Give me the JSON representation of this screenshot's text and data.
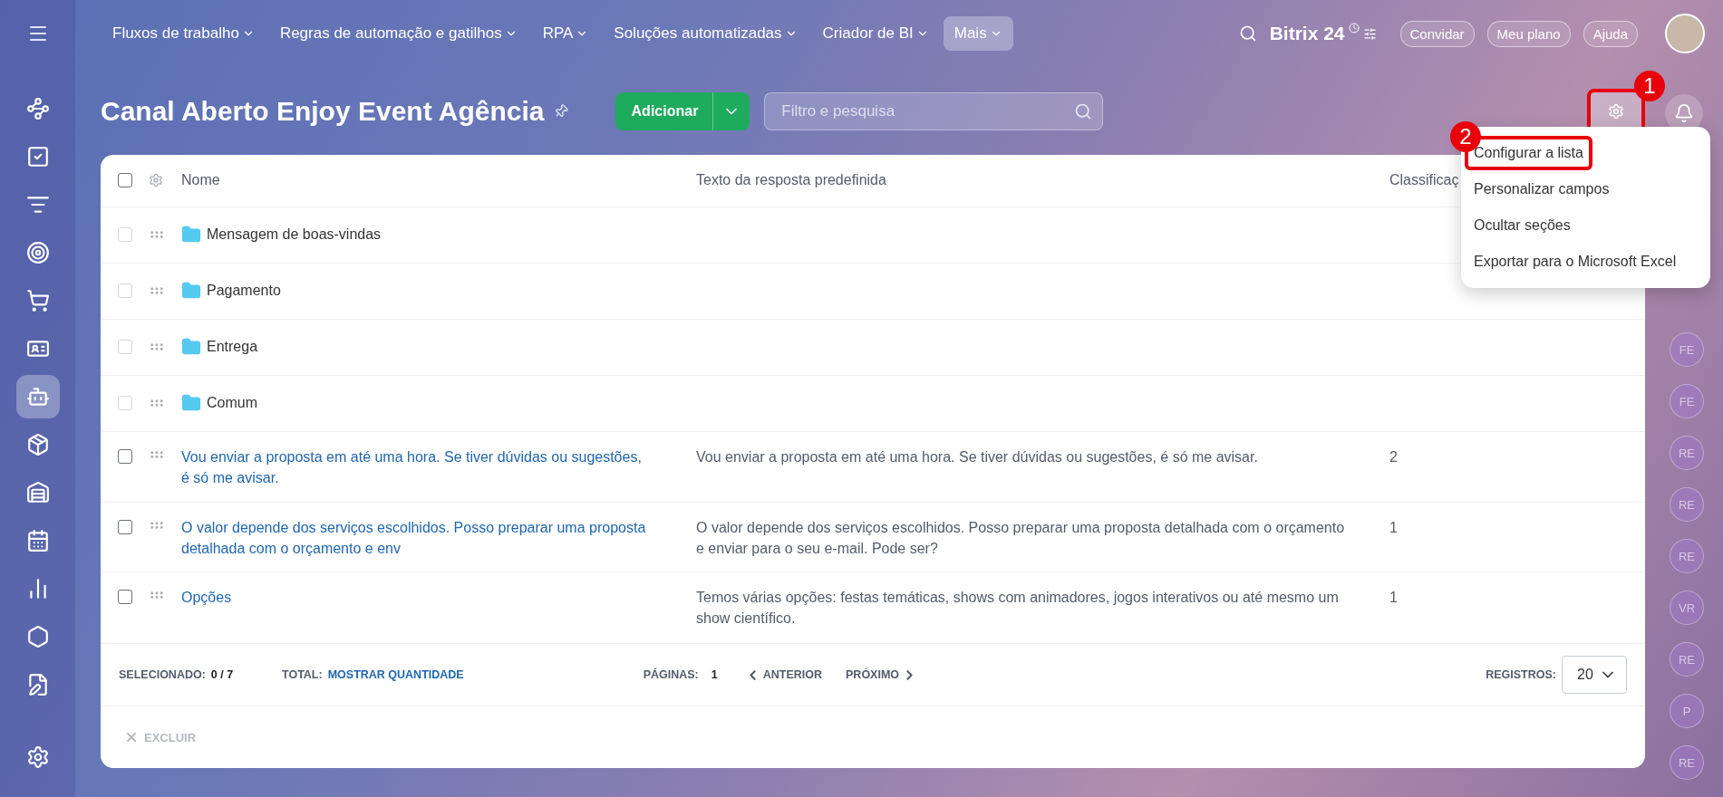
{
  "top_bar": {
    "nav": [
      {
        "label": "Fluxos de trabalho",
        "selected": false
      },
      {
        "label": "Regras de automação e gatilhos",
        "selected": false
      },
      {
        "label": "RPA",
        "selected": false
      },
      {
        "label": "Soluções automatizadas",
        "selected": false
      },
      {
        "label": "Criador de BI",
        "selected": false
      },
      {
        "label": "Mais",
        "selected": true
      }
    ],
    "logo": {
      "name": "Bitrix",
      "number": "24"
    },
    "buttons": [
      "Convidar",
      "Meu plano",
      "Ajuda"
    ]
  },
  "sidebar": {
    "items": [
      {
        "kind": "flow",
        "selected": false
      },
      {
        "kind": "tasks",
        "selected": false
      },
      {
        "kind": "funnel",
        "selected": false
      },
      {
        "kind": "target",
        "selected": false
      },
      {
        "kind": "cart",
        "selected": false
      },
      {
        "kind": "card",
        "selected": false
      },
      {
        "kind": "robot",
        "selected": true
      },
      {
        "kind": "box",
        "selected": false
      },
      {
        "kind": "warehouse",
        "selected": false
      },
      {
        "kind": "calendar",
        "selected": false
      },
      {
        "kind": "chart",
        "selected": false
      },
      {
        "kind": "hexagon",
        "selected": false
      },
      {
        "kind": "document",
        "selected": false
      }
    ]
  },
  "page": {
    "title": "Canal Aberto Enjoy Event Agência",
    "add_button": "Adicionar",
    "search": {
      "placeholder": "Filtro e pesquisa"
    },
    "settings_callout": "1"
  },
  "table": {
    "all_checked": false,
    "columns": [
      "Nome",
      "Texto da resposta predefinida",
      "Classificaç"
    ],
    "rows": [
      {
        "kind": "folder",
        "name": "Mensagem de boas-vindas",
        "checked": false
      },
      {
        "kind": "folder",
        "name": "Pagamento",
        "checked": false
      },
      {
        "kind": "folder",
        "name": "Entrega",
        "checked": false
      },
      {
        "kind": "folder",
        "name": "Comum",
        "checked": false
      },
      {
        "kind": "item",
        "name": "Vou enviar a proposta em até uma hora. Se tiver dúvidas ou sugestões, é só me avisar.",
        "text": "Vou enviar a proposta em até uma hora. Se tiver dúvidas ou sugestões, é só me avisar.",
        "rank": "2",
        "checked": false
      },
      {
        "kind": "item",
        "name": "O valor depende dos serviços escolhidos. Posso preparar uma proposta detalhada com o orçamento e env",
        "text": "O valor depende dos serviços escolhidos. Posso preparar uma proposta detalhada com o orçamento e enviar para o seu e-mail. Pode ser?",
        "rank": "1",
        "checked": false
      },
      {
        "kind": "item",
        "name": "Opções",
        "text": "Temos várias opções: festas temáticas, shows com animadores, jogos interativos ou até mesmo um show científico.",
        "rank": "1",
        "checked": false
      }
    ]
  },
  "footer": {
    "selected_label": "SELECIONADO:",
    "selected_value": "0 / 7",
    "total_label": "TOTAL:",
    "total_link": "MOSTRAR QUANTIDADE",
    "pages_label": "PÁGINAS:",
    "page": "1",
    "prev": "ANTERIOR",
    "next": "PRÓXIMO",
    "records_label": "REGISTROS:",
    "records_value": "20"
  },
  "actions": [
    {
      "label": "EXCLUIR",
      "disabled": true
    }
  ],
  "menu": {
    "items": [
      {
        "label": "Configurar a lista",
        "callout": "2"
      },
      {
        "label": "Personalizar campos"
      },
      {
        "label": "Ocultar seções"
      },
      {
        "label": "Exportar para o Microsoft Excel"
      }
    ]
  },
  "people": [
    "FE",
    "FE",
    "RE",
    "RE",
    "RE",
    "VR",
    "RE",
    "P",
    "RE"
  ]
}
